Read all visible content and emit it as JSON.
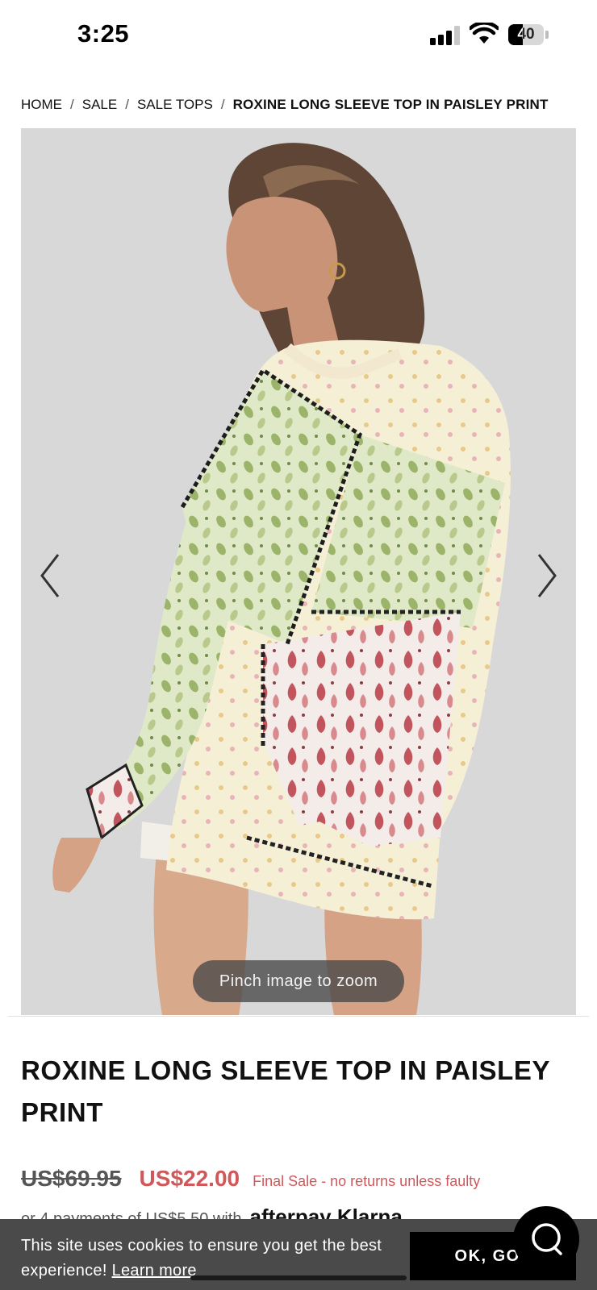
{
  "status_bar": {
    "time": "3:25",
    "battery": "40",
    "battery_level": 0.4
  },
  "breadcrumb": {
    "items": [
      "HOME",
      "SALE",
      "SALE TOPS"
    ],
    "separator": "/",
    "current": "ROXINE LONG SLEEVE TOP IN PAISLEY PRINT"
  },
  "gallery": {
    "zoom_hint": "Pinch image to zoom",
    "prev_icon": "chevron-left-icon",
    "next_icon": "chevron-right-icon"
  },
  "product": {
    "title": "ROXINE LONG SLEEVE TOP IN PAISLEY PRINT",
    "price_original": "US$69.95",
    "price_sale": "US$22.00",
    "final_sale_note": "Final Sale - no returns unless faulty",
    "installments_text": "or 4 payments of US$5.50 with",
    "payment_providers": "afterpay Klarna"
  },
  "cookie_banner": {
    "message": "This site uses cookies to ensure you get the best experience!",
    "learn_more": "Learn more",
    "ok_label": "OK, GOT"
  },
  "colors": {
    "sale_red": "#d0575a",
    "banner_gray": "#4a4a4a",
    "image_bg": "#d9d8d8"
  },
  "chat": {
    "icon": "chat-icon"
  }
}
